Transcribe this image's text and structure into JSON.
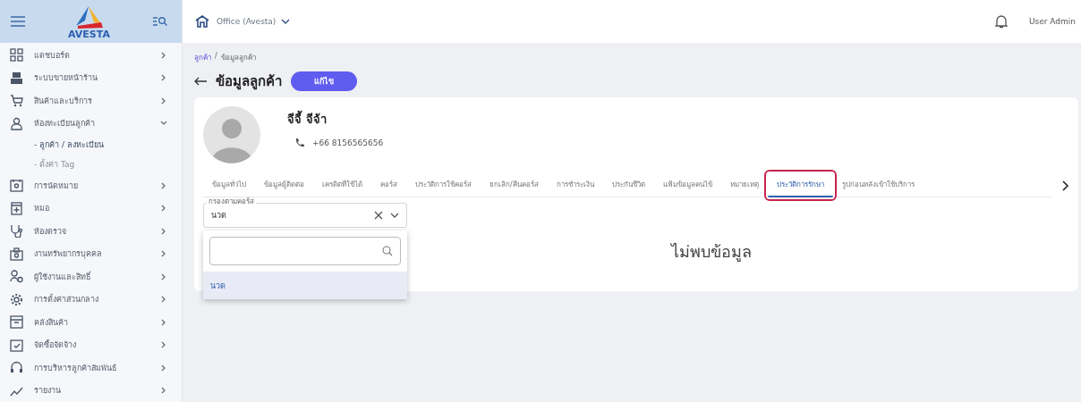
{
  "sidebar": {
    "logo": "AVESTA",
    "items": [
      {
        "label": "แดชบอร์ด",
        "expanded": false
      },
      {
        "label": "ระบบขายหน้าร้าน",
        "expanded": false
      },
      {
        "label": "สินค้าและบริการ",
        "expanded": false
      },
      {
        "label": "ห้องทะเบียนลูกค้า",
        "expanded": true,
        "children": [
          {
            "label": "- ลูกค้า / ลงทะเบียน",
            "selected": true
          },
          {
            "label": "- ตั้งค่า Tag",
            "selected": false
          }
        ]
      },
      {
        "label": "การนัดหมาย",
        "expanded": false
      },
      {
        "label": "หมอ",
        "expanded": false
      },
      {
        "label": "ห้องตรวจ",
        "expanded": false
      },
      {
        "label": "งานทรัพยากรบุคคล",
        "expanded": false
      },
      {
        "label": "ผู้ใช้งานและสิทธิ์",
        "expanded": false
      },
      {
        "label": "การตั้งค่าส่วนกลาง",
        "expanded": false
      },
      {
        "label": "คลังสินค้า",
        "expanded": false
      },
      {
        "label": "จัดซื้อจัดจ้าง",
        "expanded": false
      },
      {
        "label": "การบริหารลูกค้าสัมพันธ์",
        "expanded": false
      },
      {
        "label": "รายงาน",
        "expanded": false
      }
    ]
  },
  "topbar": {
    "branch": "Office (Avesta)",
    "user": "User Admin"
  },
  "breadcrumb_separator": "/",
  "breadcrumb": [
    {
      "label": "ลูกค้า",
      "link": true
    },
    {
      "label": "ข้อมูลลูกค้า",
      "link": false
    }
  ],
  "page_title": "ข้อมูลลูกค้า",
  "edit_button": "แก้ไข",
  "customer": {
    "name": "จีจี้  จีจ้า",
    "phone": "+66 8156565656"
  },
  "tabs": [
    {
      "label": "ข้อมูลทั่วไป",
      "selected": false,
      "highlighted": false
    },
    {
      "label": "ข้อมูลผู้ติดต่อ",
      "selected": false,
      "highlighted": false
    },
    {
      "label": "เครดิตที่ใช้ได้",
      "selected": false,
      "highlighted": false
    },
    {
      "label": "คอร์ส",
      "selected": false,
      "highlighted": false
    },
    {
      "label": "ประวัติการใช้คอร์ส",
      "selected": false,
      "highlighted": false
    },
    {
      "label": "ยกเลิก/คืนคอร์ส",
      "selected": false,
      "highlighted": false
    },
    {
      "label": "การชำระเงิน",
      "selected": false,
      "highlighted": false
    },
    {
      "label": "ประกันชีวิต",
      "selected": false,
      "highlighted": false
    },
    {
      "label": "แฟ้มข้อมูลคนไข้",
      "selected": false,
      "highlighted": false
    },
    {
      "label": "หมายเหตุ",
      "selected": false,
      "highlighted": false
    },
    {
      "label": "ประวัติการรักษา",
      "selected": true,
      "highlighted": true
    },
    {
      "label": "รูปก่อนหลังเข้าใช้บริการ",
      "selected": false,
      "highlighted": false
    }
  ],
  "course_filter": {
    "label": "กรองตามคอร์ส",
    "value": "นวด",
    "open": true,
    "options": [
      {
        "label": "นวด",
        "selected": true
      }
    ]
  },
  "empty_message": "ไม่พบข้อมูล"
}
